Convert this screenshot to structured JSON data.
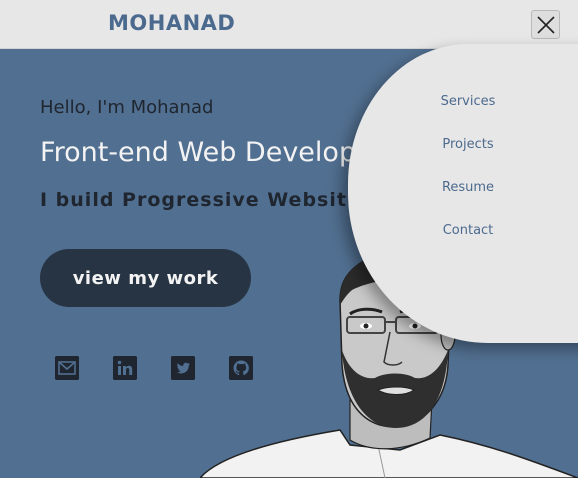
{
  "header": {
    "logo": "MOHANAD",
    "close_icon": "close-icon"
  },
  "hero": {
    "greeting": "Hello, I'm Mohanad",
    "role": "Front-end Web Developer",
    "tagline": "I build Progressive Websites",
    "cta_label": "view my work"
  },
  "social": [
    {
      "name": "email",
      "icon": "envelope-icon"
    },
    {
      "name": "linkedin",
      "icon": "linkedin-icon"
    },
    {
      "name": "twitter",
      "icon": "twitter-icon"
    },
    {
      "name": "github",
      "icon": "github-icon"
    }
  ],
  "menu": {
    "items": [
      {
        "label": "Services"
      },
      {
        "label": "Projects"
      },
      {
        "label": "Resume"
      },
      {
        "label": "Contact"
      }
    ]
  },
  "colors": {
    "background": "#516f90",
    "topbar": "#e8e7e8",
    "accent": "#4b6a8d",
    "button": "#273444",
    "dark_text": "#1f2630"
  }
}
